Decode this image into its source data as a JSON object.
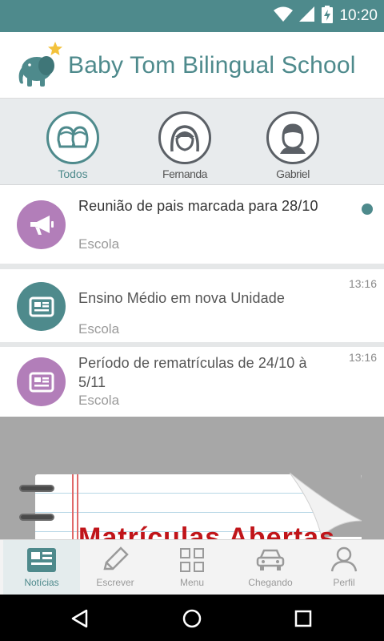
{
  "status_bar": {
    "time": "10:20",
    "icons": [
      "wifi-icon",
      "signal-icon",
      "battery-charging-icon"
    ]
  },
  "header": {
    "title": "Baby Tom Bilingual School",
    "logo": "elephant-star-logo"
  },
  "filters": [
    {
      "label": "Todos",
      "icon": "group-avatar-icon",
      "active": true
    },
    {
      "label": "Fernanda",
      "icon": "girl-avatar-icon",
      "active": false
    },
    {
      "label": "Gabriel",
      "icon": "boy-avatar-icon",
      "active": false
    }
  ],
  "feed": {
    "items": [
      {
        "title": "Reunião de pais marcada para 28/10",
        "source": "Escola",
        "time": "",
        "icon": "megaphone-icon",
        "icon_color": "#b27eb9",
        "unread": true
      },
      {
        "title": "Ensino Médio em nova Unidade",
        "source": "Escola",
        "time": "13:16",
        "icon": "newspaper-icon",
        "icon_color": "#4e8a8c",
        "unread": false
      },
      {
        "title": "Período de rematrículas de 24/10 à 5/11",
        "source": "Escola",
        "time": "13:16",
        "icon": "newspaper-icon",
        "icon_color": "#b27eb9",
        "unread": false
      }
    ],
    "banner_text": "Matrículas Abertas"
  },
  "bottom_nav": [
    {
      "label": "Notícias",
      "icon": "news-icon",
      "active": true
    },
    {
      "label": "Escrever",
      "icon": "pencil-icon",
      "active": false
    },
    {
      "label": "Menu",
      "icon": "grid-icon",
      "active": false
    },
    {
      "label": "Chegando",
      "icon": "car-icon",
      "active": false
    },
    {
      "label": "Perfil",
      "icon": "person-icon",
      "active": false
    }
  ],
  "colors": {
    "accent": "#4e8a8c",
    "purple": "#b27eb9",
    "banner_red": "#c0151a"
  }
}
